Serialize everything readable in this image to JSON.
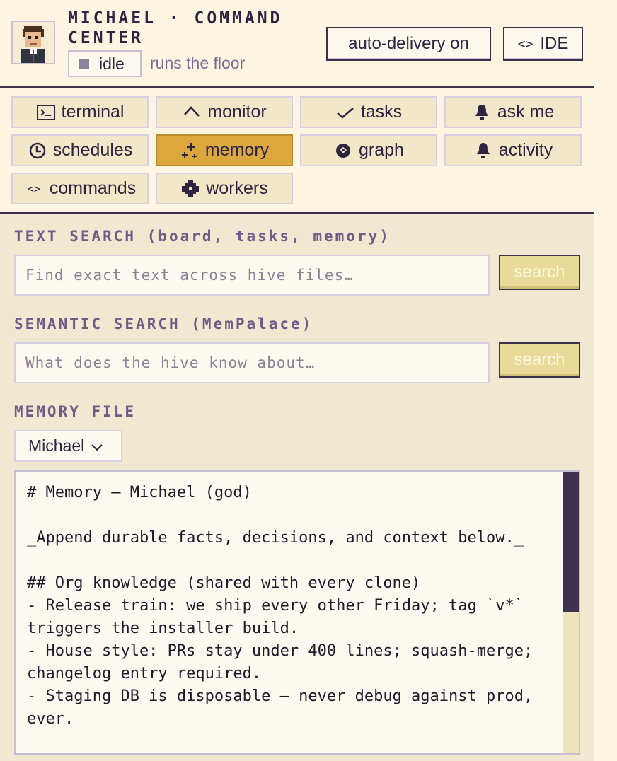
{
  "header": {
    "title": "MICHAEL · COMMAND CENTER",
    "status": "idle",
    "subtitle": "runs the floor",
    "auto_delivery_label": "auto-delivery on",
    "ide_label": "IDE",
    "ide_icon": "code-brackets-icon"
  },
  "nav": {
    "items": [
      {
        "label": "terminal",
        "icon": "terminal-icon"
      },
      {
        "label": "monitor",
        "icon": "monitor-icon"
      },
      {
        "label": "tasks",
        "icon": "check-icon"
      },
      {
        "label": "ask me",
        "icon": "bell-icon"
      },
      {
        "label": "schedules",
        "icon": "clock-icon"
      },
      {
        "label": "memory",
        "icon": "sparkle-icon",
        "active": true
      },
      {
        "label": "graph",
        "icon": "graph-icon"
      },
      {
        "label": "activity",
        "icon": "bell-icon"
      },
      {
        "label": "commands",
        "icon": "code-brackets-icon"
      },
      {
        "label": "workers",
        "icon": "gear-icon"
      }
    ]
  },
  "main": {
    "text_search": {
      "label": "TEXT SEARCH (board, tasks, memory)",
      "placeholder": "Find exact text across hive files…",
      "button": "search"
    },
    "semantic_search": {
      "label": "SEMANTIC SEARCH (MemPalace)",
      "placeholder": "What does the hive know about…",
      "button": "search"
    },
    "memory_file": {
      "label": "MEMORY FILE",
      "selected": "Michael",
      "content": "# Memory — Michael (god)\n\n_Append durable facts, decisions, and context below._\n\n## Org knowledge (shared with every clone)\n- Release train: we ship every other Friday; tag `v*` triggers the installer build.\n- House style: PRs stay under 400 lines; squash-merge; changelog entry required.\n- Staging DB is disposable — never debug against prod, ever."
    }
  },
  "colors": {
    "accent": "#dca83d",
    "background": "#fbf5e2",
    "panel": "#f0e8d0",
    "ink": "#2e2440",
    "label": "#6e5c88"
  }
}
